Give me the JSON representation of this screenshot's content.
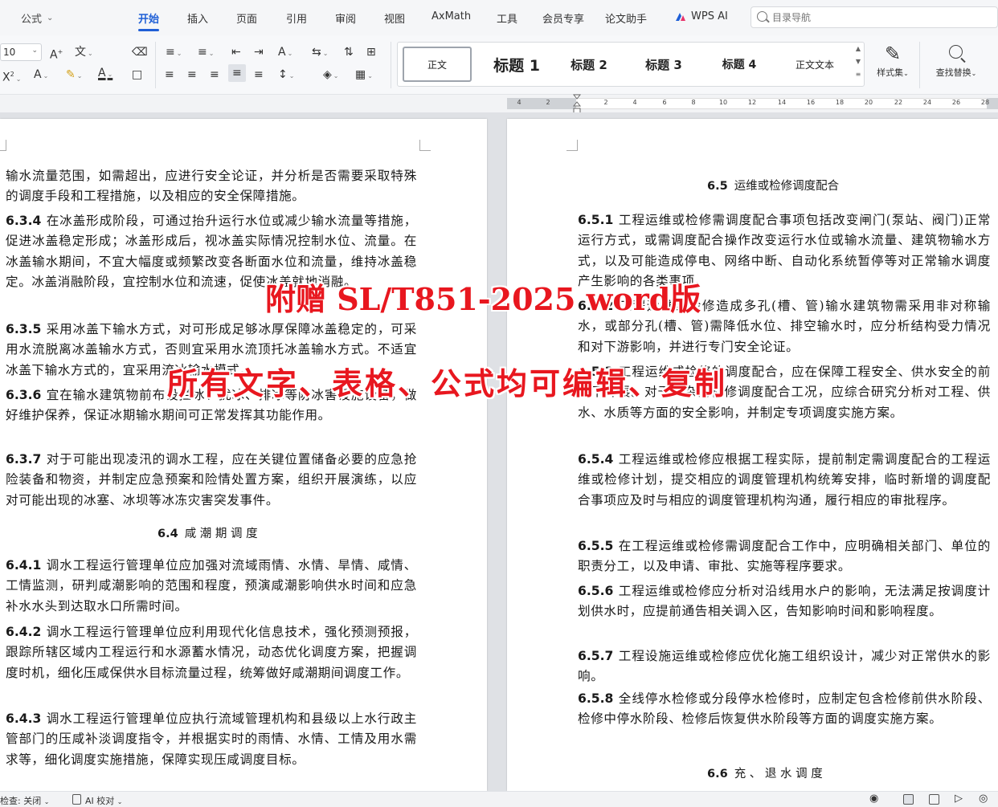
{
  "menubar": {
    "formula_box": "公式",
    "tabs": [
      "开始",
      "插入",
      "页面",
      "引用",
      "审阅",
      "视图",
      "AxMath",
      "工具",
      "会员专享",
      "论文助手",
      "WPS AI"
    ],
    "active_tab": "开始",
    "search_placeholder": "目录导航"
  },
  "ribbon": {
    "font_size": "10",
    "styles": [
      "正文",
      "标题 1",
      "标题 2",
      "标题 3",
      "标题 4",
      "正文文本"
    ],
    "style_set_label": "样式集",
    "find_replace_label": "查找替换"
  },
  "ruler": {
    "ticks": [
      "4",
      "2",
      "2",
      "4",
      "6",
      "8",
      "10",
      "12",
      "14",
      "16",
      "18",
      "20",
      "22",
      "24",
      "26",
      "28"
    ]
  },
  "left_page": {
    "blocks": [
      {
        "num": "",
        "text": "输水流量范围，如需超出，应进行安全论证，并分析是否需要采取特殊的调度手段和工程措施，以及相应的安全保障措施。"
      },
      {
        "num": "6.3.4",
        "text": "在冰盖形成阶段，可通过抬升运行水位或减少输水流量等措施，促进冰盖稳定形成；冰盖形成后，视冰盖实际情况控制水位、流量。在冰盖输水期间，不宜大幅度或频繁改变各断面水位和流量，维持冰盖稳定。冰盖消融阶段，宜控制水位和流速，促使冰盖就地消融。"
      },
      {
        "num": "6.3.5",
        "text": "采用冰盖下输水方式，对可形成足够冰厚保障冰盖稳定的，可采用水流脱离冰盖输水方式，否则宜采用水流顶托冰盖输水方式。不适宜冰盖下输水方式的，宜采用流冰输水模式。"
      },
      {
        "num": "6.3.6",
        "text": "宜在输水建筑物前布设拦冰、扰冰、排冰等防冰害设施设备，做好维护保养，保证冰期输水期间可正常发挥其功能作用。"
      },
      {
        "num": "6.3.7",
        "text": "对于可能出现凌汛的调水工程，应在关键位置储备必要的应急抢险装备和物资，并制定应急预案和险情处置方案，组织开展演练，以应对可能出现的冰塞、冰坝等冰冻灾害突发事件。"
      },
      {
        "num": "6.4",
        "text": "咸 潮 期 调 度",
        "heading": true
      },
      {
        "num": "6.4.1",
        "text": "调水工程运行管理单位应加强对流域雨情、水情、旱情、咸情、工情监测，研判咸潮影响的范围和程度，预演咸潮影响供水时间和应急补水水头到达取水口所需时间。"
      },
      {
        "num": "6.4.2",
        "text": "调水工程运行管理单位应利用现代化信息技术，强化预测预报，跟踪所辖区域内工程运行和水源蓄水情况，动态优化调度方案，把握调度时机，细化压咸保供水目标流量过程，统筹做好咸潮期间调度工作。"
      },
      {
        "num": "6.4.3",
        "text": "调水工程运行管理单位应执行流域管理机构和县级以上水行政主管部门的压咸补淡调度指令，并根据实时的雨情、水情、工情及用水需求等，细化调度实施措施，保障实现压咸调度目标。"
      }
    ]
  },
  "right_page": {
    "blocks": [
      {
        "num": "6.5",
        "text": "运维或检修调度配合",
        "heading": true
      },
      {
        "num": "6.5.1",
        "text": "工程运维或检修需调度配合事项包括改变闸门(泵站、阀门)正常运行方式，或需调度配合操作改变运行水位或输水流量、建筑物输水方式，以及可能造成停电、网络中断、自动化系统暂停等对正常输水调度产生影响的各类事项。"
      },
      {
        "num": "6.5.2",
        "text": "工程运维或检修造成多孔(槽、管)输水建筑物需采用非对称输水，或部分孔(槽、管)需降低水位、排空输水时，应分析结构受力情况和对下游影响，并进行专门安全论证。"
      },
      {
        "num": "6.5.3",
        "text": "工程运维或检修的调度配合，应在保障工程安全、供水安全的前提下开展。对于复杂的检修调度配合工况，应综合研究分析对工程、供水、水质等方面的安全影响，并制定专项调度实施方案。"
      },
      {
        "num": "6.5.4",
        "text": "工程运维或检修应根据工程实际，提前制定需调度配合的工程运维或检修计划，提交相应的调度管理机构统筹安排，临时新增的调度配合事项应及时与相应的调度管理机构沟通，履行相应的审批程序。"
      },
      {
        "num": "6.5.5",
        "text": "在工程运维或检修需调度配合工作中，应明确相关部门、单位的职责分工，以及申请、审批、实施等程序要求。"
      },
      {
        "num": "6.5.6",
        "text": "工程运维或检修应分析对沿线用水户的影响，无法满足按调度计划供水时，应提前通告相关调入区，告知影响时间和影响程度。"
      },
      {
        "num": "6.5.7",
        "text": "工程设施运维或检修应优化施工组织设计，减少对正常供水的影响。"
      },
      {
        "num": "6.5.8",
        "text": "全线停水检修或分段停水检修时，应制定包含检修前供水阶段、检修中停水阶段、检修后恢复供水阶段等方面的调度实施方案。"
      },
      {
        "num": "6.6",
        "text": "充 、 退 水 调 度",
        "heading": true
      }
    ]
  },
  "watermark": {
    "line1": "附赠 SL/T851-2025 word版",
    "line2": "所有文字、表格、公式均可编辑、复制"
  },
  "statusbar": {
    "check": "检查: 关闭",
    "ai_check": "AI 校对"
  }
}
